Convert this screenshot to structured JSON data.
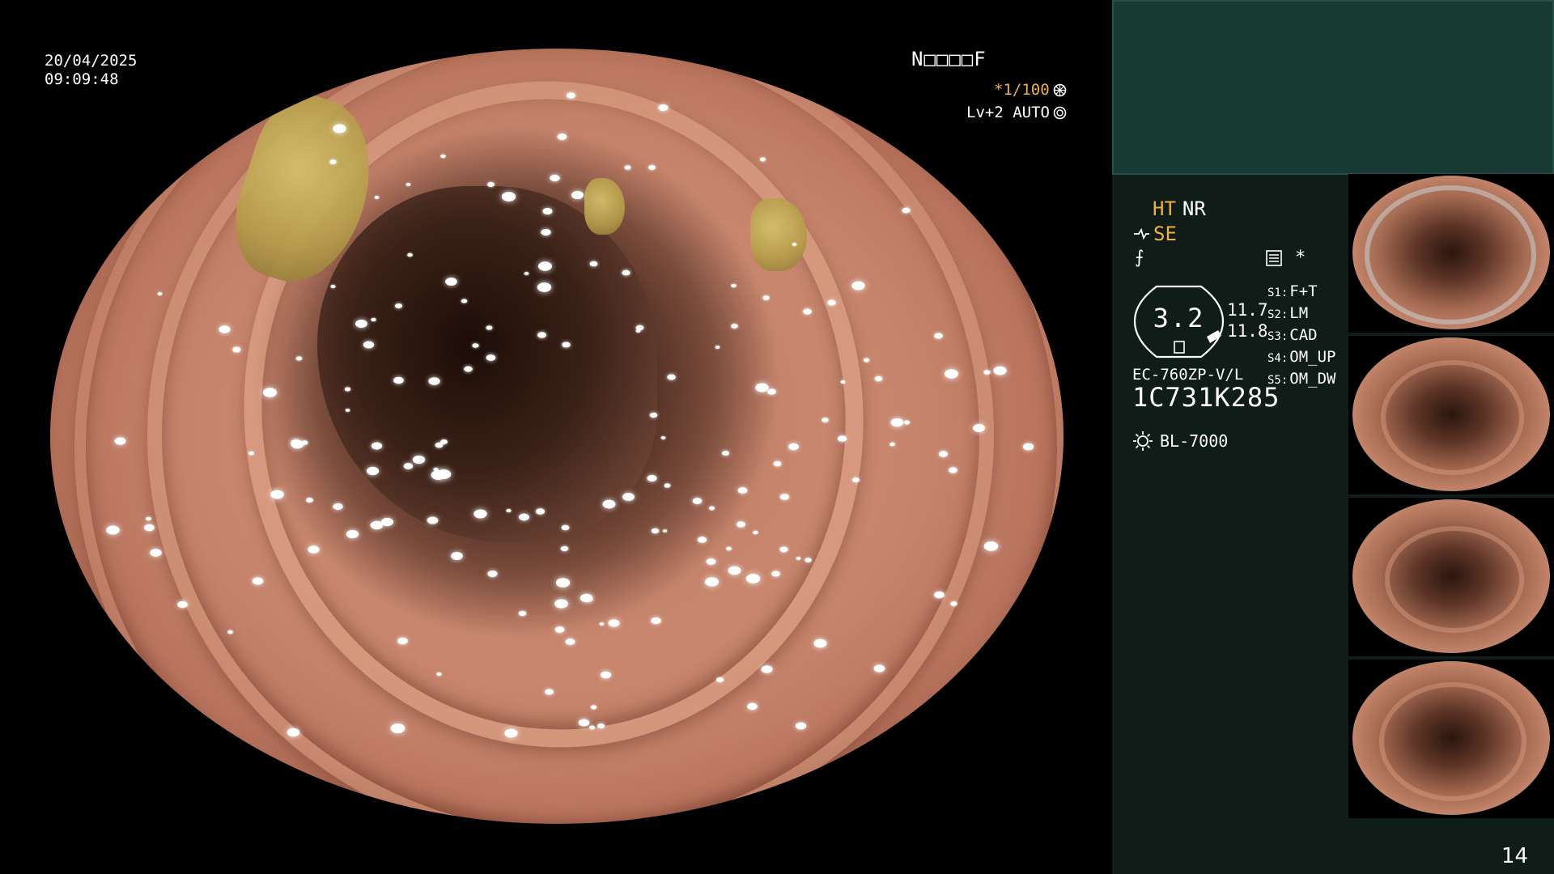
{
  "overlay": {
    "date": "20/04/2025",
    "time": "09:09:48",
    "patient_id": "N□□□□F",
    "zoom": "*1/100",
    "zoom_icon": "shutter-icon",
    "level": "Lv+2 AUTO",
    "level_icon": "iris-icon"
  },
  "panel": {
    "ht_label": "HT",
    "nr_label": "NR",
    "se_label": "SE",
    "f_symbol": "⨍",
    "mode_icon": "menu-grid-icon",
    "star": "*",
    "gauge_value": "3.2",
    "side_top": "11.7",
    "side_bottom": "11.8",
    "s_items": [
      {
        "key": "S1:",
        "value": "F+T"
      },
      {
        "key": "S2:",
        "value": "LM"
      },
      {
        "key": "S3:",
        "value": "CAD"
      },
      {
        "key": "S4:",
        "value": "OM_UP"
      },
      {
        "key": "S5:",
        "value": "OM_DW"
      }
    ],
    "scope_model": "EC-760ZP-V/L",
    "scope_serial": "1C731K285",
    "light_icon": "sun-icon",
    "light_source": "BL-7000",
    "page_number": "14"
  },
  "colors": {
    "accent_orange": "#f0b040",
    "panel_bg": "#0f1c18",
    "panel_top_bg": "#173a33"
  }
}
